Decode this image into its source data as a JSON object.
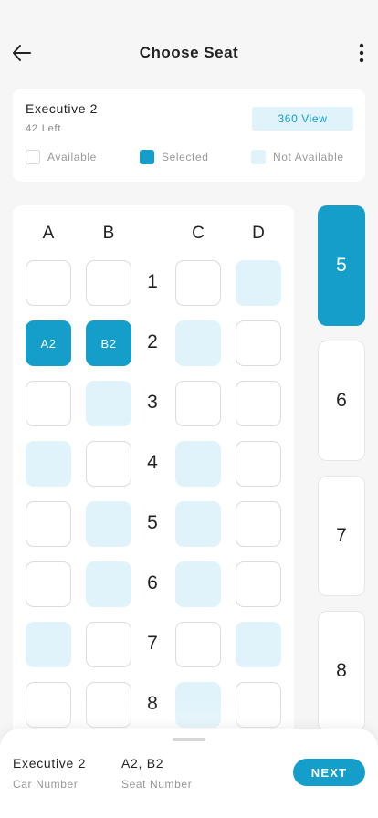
{
  "header": {
    "title": "Choose Seat",
    "back_icon": "arrow-left-icon",
    "more_icon": "more-vertical-icon"
  },
  "car_info": {
    "name": "Executive 2",
    "seats_left": "42 Left",
    "view_button": "360 View"
  },
  "legend": {
    "available": "Available",
    "selected": "Selected",
    "not_available": "Not Available"
  },
  "seat_map": {
    "columns": [
      "A",
      "B",
      "C",
      "D"
    ],
    "rows": [
      {
        "number": "1",
        "seats": [
          {
            "status": "available",
            "label": ""
          },
          {
            "status": "available",
            "label": ""
          },
          {
            "status": "available",
            "label": ""
          },
          {
            "status": "na",
            "label": ""
          }
        ]
      },
      {
        "number": "2",
        "seats": [
          {
            "status": "selected",
            "label": "A2"
          },
          {
            "status": "selected",
            "label": "B2"
          },
          {
            "status": "na",
            "label": ""
          },
          {
            "status": "available",
            "label": ""
          }
        ]
      },
      {
        "number": "3",
        "seats": [
          {
            "status": "available",
            "label": ""
          },
          {
            "status": "na",
            "label": ""
          },
          {
            "status": "available",
            "label": ""
          },
          {
            "status": "available",
            "label": ""
          }
        ]
      },
      {
        "number": "4",
        "seats": [
          {
            "status": "na",
            "label": ""
          },
          {
            "status": "available",
            "label": ""
          },
          {
            "status": "na",
            "label": ""
          },
          {
            "status": "available",
            "label": ""
          }
        ]
      },
      {
        "number": "5",
        "seats": [
          {
            "status": "available",
            "label": ""
          },
          {
            "status": "na",
            "label": ""
          },
          {
            "status": "na",
            "label": ""
          },
          {
            "status": "available",
            "label": ""
          }
        ]
      },
      {
        "number": "6",
        "seats": [
          {
            "status": "available",
            "label": ""
          },
          {
            "status": "na",
            "label": ""
          },
          {
            "status": "na",
            "label": ""
          },
          {
            "status": "available",
            "label": ""
          }
        ]
      },
      {
        "number": "7",
        "seats": [
          {
            "status": "na",
            "label": ""
          },
          {
            "status": "available",
            "label": ""
          },
          {
            "status": "available",
            "label": ""
          },
          {
            "status": "na",
            "label": ""
          }
        ]
      },
      {
        "number": "8",
        "seats": [
          {
            "status": "available",
            "label": ""
          },
          {
            "status": "available",
            "label": ""
          },
          {
            "status": "na",
            "label": ""
          },
          {
            "status": "available",
            "label": ""
          }
        ]
      }
    ]
  },
  "car_tabs": [
    {
      "label": "5",
      "active": true
    },
    {
      "label": "6",
      "active": false
    },
    {
      "label": "7",
      "active": false
    },
    {
      "label": "8",
      "active": false
    }
  ],
  "summary": {
    "car_number": "Executive 2",
    "car_number_label": "Car Number",
    "seat_number": "A2, B2",
    "seat_number_label": "Seat Number",
    "next_button": "NEXT"
  },
  "colors": {
    "accent": "#169ecb",
    "not_available": "#e0f3fb",
    "background": "#f6f6f6"
  }
}
